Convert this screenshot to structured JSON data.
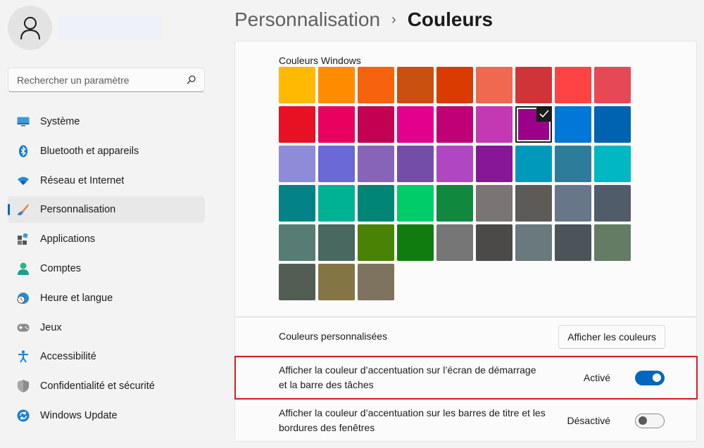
{
  "sidebar": {
    "search": {
      "placeholder": "Rechercher un paramètre"
    },
    "items": [
      {
        "label": "Système",
        "icon": "monitor-icon"
      },
      {
        "label": "Bluetooth et appareils",
        "icon": "bluetooth-icon"
      },
      {
        "label": "Réseau et Internet",
        "icon": "wifi-icon"
      },
      {
        "label": "Personnalisation",
        "icon": "brush-icon",
        "selected": true
      },
      {
        "label": "Applications",
        "icon": "apps-icon"
      },
      {
        "label": "Comptes",
        "icon": "person-icon"
      },
      {
        "label": "Heure et langue",
        "icon": "globe-clock-icon"
      },
      {
        "label": "Jeux",
        "icon": "gamepad-icon"
      },
      {
        "label": "Accessibilité",
        "icon": "accessibility-icon"
      },
      {
        "label": "Confidentialité et sécurité",
        "icon": "shield-icon"
      },
      {
        "label": "Windows Update",
        "icon": "sync-icon"
      }
    ]
  },
  "header": {
    "parent": "Personnalisation",
    "separator": "›",
    "current": "Couleurs"
  },
  "colors": {
    "title": "Couleurs Windows",
    "selected_index": 15,
    "swatches": [
      "#FFB900",
      "#FF8C00",
      "#F7630C",
      "#CA5010",
      "#DA3B01",
      "#EF6950",
      "#D13438",
      "#FF4343",
      "#E74856",
      "#E81123",
      "#EA005E",
      "#C30052",
      "#E3008C",
      "#BF0077",
      "#C239B3",
      "#9A0089",
      "#0078D7",
      "#0063B1",
      "#8E8CD8",
      "#6B69D6",
      "#8764B8",
      "#744DA9",
      "#B146C2",
      "#881798",
      "#0099BC",
      "#2D7D9A",
      "#00B7C3",
      "#038387",
      "#00B294",
      "#018574",
      "#00CC6A",
      "#10893E",
      "#7A7574",
      "#5D5A58",
      "#68768A",
      "#515C6B",
      "#567C73",
      "#486860",
      "#498205",
      "#107C10",
      "#767676",
      "#4C4A48",
      "#69797E",
      "#4A5459",
      "#647C64",
      "#525E54",
      "#847545",
      "#7E735F"
    ]
  },
  "custom_colors": {
    "label": "Couleurs personnalisées",
    "button": "Afficher les couleurs"
  },
  "accent_start": {
    "label": "Afficher la couleur d’accentuation sur l’écran de démarrage et la barre des tâches",
    "state": "Activé",
    "on": true
  },
  "accent_title": {
    "label": "Afficher la couleur d’accentuation sur les barres de titre et les bordures des fenêtres",
    "state": "Désactivé",
    "on": false
  },
  "accent_color": "#0067C0",
  "highlight_color": "#D6202A"
}
